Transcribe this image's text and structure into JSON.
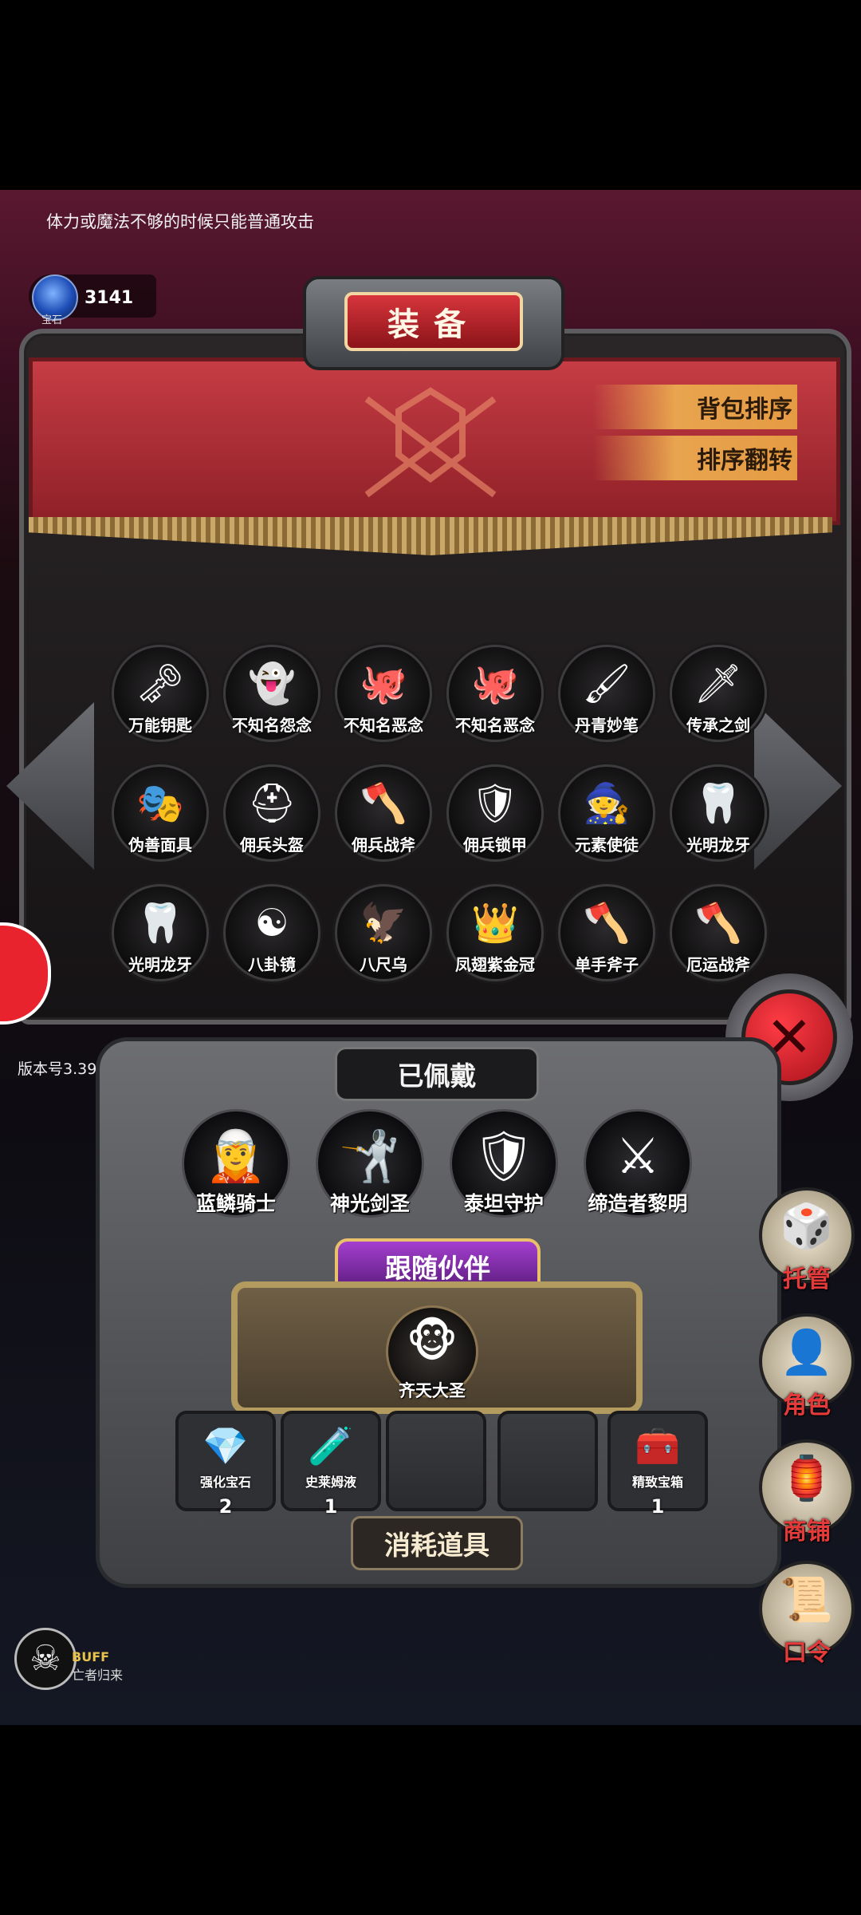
{
  "hint": "体力或魔法不够的时候只能普通攻击",
  "currency": {
    "label": "宝石",
    "count": "3141",
    "icon": "blue-gem-icon"
  },
  "title": "装备",
  "buttons": {
    "sort": "背包排序",
    "reverse": "排序翻转",
    "close": "✕"
  },
  "inventory": [
    {
      "label": "万能钥匙",
      "icon": "🗝"
    },
    {
      "label": "不知名怨念",
      "icon": "👻"
    },
    {
      "label": "不知名恶念",
      "icon": "🐙"
    },
    {
      "label": "不知名恶念",
      "icon": "🐙"
    },
    {
      "label": "丹青妙笔",
      "icon": "🖌"
    },
    {
      "label": "传承之剑",
      "icon": "🗡"
    },
    {
      "label": "伪善面具",
      "icon": "🎭"
    },
    {
      "label": "佣兵头盔",
      "icon": "⛑"
    },
    {
      "label": "佣兵战斧",
      "icon": "🪓"
    },
    {
      "label": "佣兵锁甲",
      "icon": "🛡"
    },
    {
      "label": "元素使徒",
      "icon": "🧙"
    },
    {
      "label": "光明龙牙",
      "icon": "🦷"
    },
    {
      "label": "光明龙牙",
      "icon": "🦷"
    },
    {
      "label": "八卦镜",
      "icon": "☯"
    },
    {
      "label": "八尺乌",
      "icon": "🦅"
    },
    {
      "label": "凤翅紫金冠",
      "icon": "👑"
    },
    {
      "label": "单手斧子",
      "icon": "🪓"
    },
    {
      "label": "厄运战斧",
      "icon": "🪓"
    }
  ],
  "version": "版本号3.39",
  "equipped": {
    "title": "已佩戴",
    "items": [
      {
        "label": "蓝鳞骑士",
        "icon": "🧝"
      },
      {
        "label": "神光剑圣",
        "icon": "🤺"
      },
      {
        "label": "泰坦守护",
        "icon": "🛡"
      },
      {
        "label": "缔造者黎明",
        "icon": "⚔"
      }
    ]
  },
  "companion": {
    "title": "跟随伙伴",
    "label": "齐天大圣",
    "icon": "🐵"
  },
  "consumables": {
    "title": "消耗道具",
    "slots": [
      {
        "label": "强化宝石",
        "count": "2",
        "icon": "💎"
      },
      {
        "label": "史莱姆液",
        "count": "1",
        "icon": "🧪"
      },
      {
        "label": "",
        "count": "",
        "icon": ""
      },
      {
        "label": "",
        "count": "",
        "icon": ""
      },
      {
        "label": "精致宝箱",
        "count": "1",
        "icon": "🧰"
      }
    ]
  },
  "side_menu": [
    {
      "label": "托管",
      "icon": "🎲"
    },
    {
      "label": "角色",
      "icon": "👤"
    },
    {
      "label": "商铺",
      "icon": "🏮"
    },
    {
      "label": "口令",
      "icon": "📜"
    }
  ],
  "buff": {
    "label": "BUFF",
    "sub": "亡者归来",
    "icon": "☠"
  }
}
